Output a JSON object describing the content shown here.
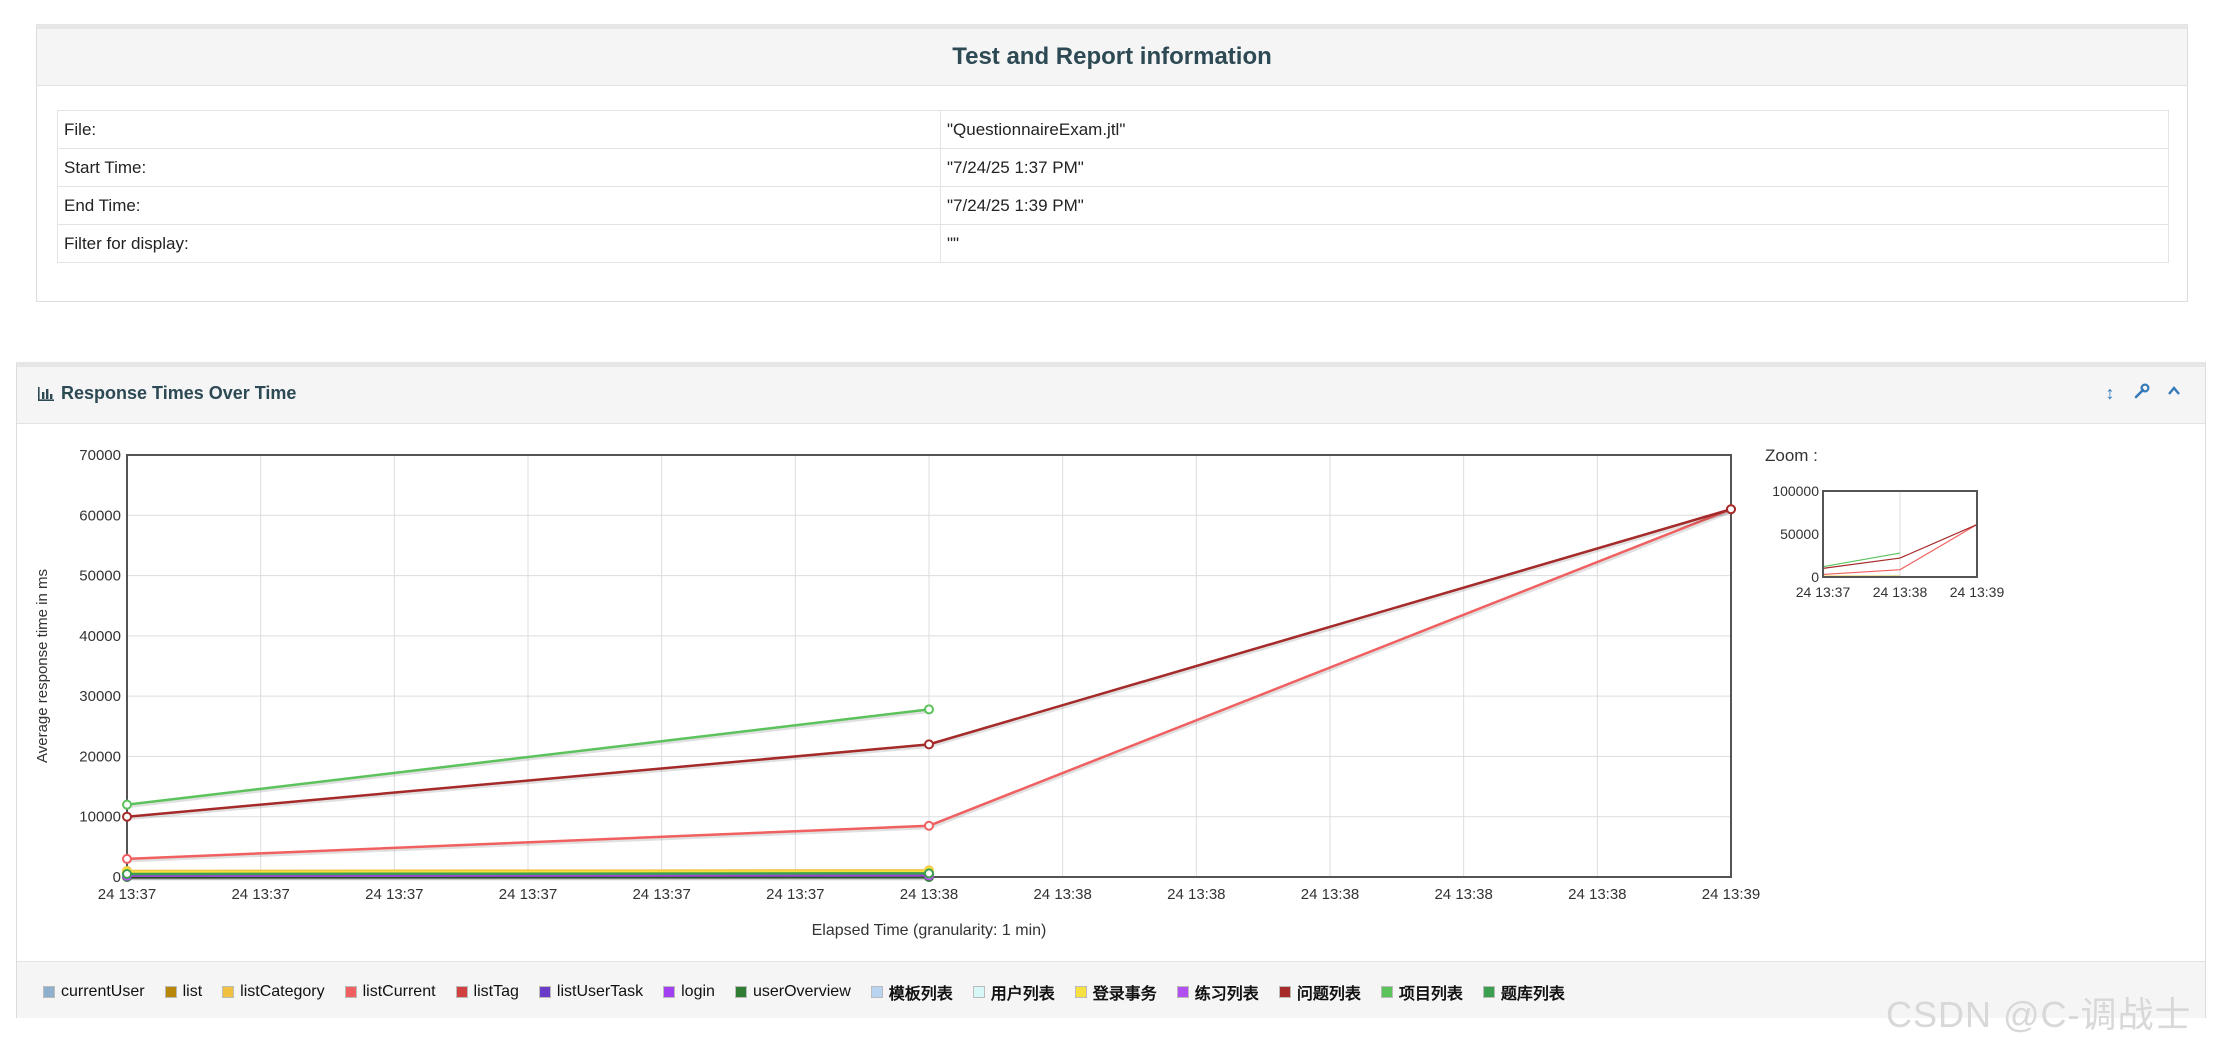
{
  "report": {
    "title": "Test and Report information",
    "rows": [
      {
        "key": "File:",
        "value": "\"QuestionnaireExam.jtl\""
      },
      {
        "key": "Start Time:",
        "value": "\"7/24/25 1:37 PM\""
      },
      {
        "key": "End Time:",
        "value": "\"7/24/25 1:39 PM\""
      },
      {
        "key": "Filter for display:",
        "value": "\"\""
      }
    ]
  },
  "graph_panel": {
    "title": "Response Times Over Time",
    "icons": [
      "chart-icon",
      "resize-icon",
      "wrench-icon",
      "collapse-icon"
    ]
  },
  "chart_data": {
    "type": "line",
    "ylabel": "Average response time in ms",
    "xlabel": "Elapsed Time (granularity: 1 min)",
    "ylim": [
      0,
      70000
    ],
    "yticks": [
      "70000",
      "60000",
      "50000",
      "40000",
      "30000",
      "20000",
      "10000",
      "0"
    ],
    "x_tick_labels": [
      "24 13:37",
      "24 13:37",
      "24 13:37",
      "24 13:37",
      "24 13:37",
      "24 13:37",
      "24 13:38",
      "24 13:38",
      "24 13:38",
      "24 13:38",
      "24 13:38",
      "24 13:38",
      "24 13:39"
    ],
    "x_points": [
      "24 13:37",
      "24 13:38",
      "24 13:39"
    ],
    "grid": true,
    "series": [
      {
        "name": "currentUser",
        "color": "#8eb0cc",
        "values": [
          300,
          400,
          null
        ]
      },
      {
        "name": "list",
        "color": "#b8860b",
        "values": [
          500,
          600,
          null
        ]
      },
      {
        "name": "listCategory",
        "color": "#f0c040",
        "values": [
          1000,
          1100,
          null
        ]
      },
      {
        "name": "listCurrent",
        "color": "#f06060",
        "values": [
          3000,
          8500,
          61000
        ]
      },
      {
        "name": "listTag",
        "color": "#d04040",
        "values": [
          200,
          300,
          null
        ]
      },
      {
        "name": "listUserTask",
        "color": "#6a3cc8",
        "values": [
          100,
          150,
          null
        ]
      },
      {
        "name": "login",
        "color": "#a040f0",
        "values": [
          250,
          350,
          null
        ]
      },
      {
        "name": "userOverview",
        "color": "#2e7d32",
        "values": [
          0,
          0,
          null
        ]
      },
      {
        "name": "模板列表",
        "color": "#b8d4f0",
        "values": [
          400,
          500,
          null
        ]
      },
      {
        "name": "用户列表",
        "color": "#d8f8f8",
        "values": [
          350,
          450,
          null
        ]
      },
      {
        "name": "登录事务",
        "color": "#f8e040",
        "values": [
          800,
          900,
          null
        ]
      },
      {
        "name": "练习列表",
        "color": "#b050f0",
        "values": [
          200,
          250,
          null
        ]
      },
      {
        "name": "问题列表",
        "color": "#a52a2a",
        "values": [
          10000,
          22000,
          61000
        ]
      },
      {
        "name": "项目列表",
        "color": "#5cc35c",
        "values": [
          12000,
          27800,
          null
        ]
      },
      {
        "name": "题库列表",
        "color": "#3aa050",
        "values": [
          500,
          600,
          null
        ]
      }
    ]
  },
  "zoom": {
    "label": "Zoom :",
    "ylim": [
      0,
      100000
    ],
    "yticks": [
      "100000",
      "50000",
      "0"
    ],
    "xticks": [
      "24 13:37",
      "24 13:38",
      "24 13:39"
    ]
  },
  "watermark": "CSDN @C-调战士"
}
